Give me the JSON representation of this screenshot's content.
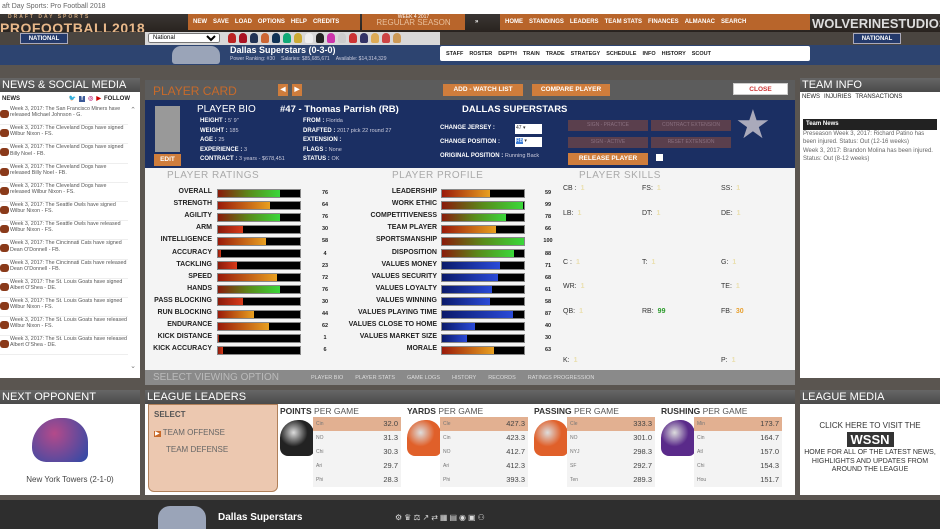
{
  "window_title": "aft Day Sports: Pro Football 2018",
  "logo": {
    "top": "DRAFT DAY SPORTS",
    "main": "PROFOOTBALL2018"
  },
  "menu": [
    "NEW",
    "SAVE",
    "LOAD",
    "OPTIONS",
    "HELP",
    "CREDITS"
  ],
  "week": {
    "line": "WEEK 4 2017",
    "season": "REGULAR SEASON"
  },
  "nav": [
    "HOME",
    "STANDINGS",
    "LEADERS",
    "TEAM STATS",
    "FINANCES",
    "ALMANAC",
    "SEARCH"
  ],
  "studio": "WOLVERINESTUDIOS",
  "conference_badge": "NATIONAL",
  "team_select": "National",
  "team_helmet_colors": [
    "#b22",
    "#a12",
    "#235",
    "#c63",
    "#135",
    "#1a7",
    "#ca3",
    "#eee",
    "#222",
    "#c3a",
    "#ccc",
    "#c33",
    "#336",
    "#da5",
    "#c44",
    "#c95"
  ],
  "team": {
    "name": "Dallas Superstars (0-3-0)",
    "power_ranking": "Power Ranking: #30",
    "salaries": "Salaries: $85,685,671",
    "available": "Available: $14,314,329"
  },
  "team_buttons": [
    "STAFF",
    "ROSTER",
    "DEPTH",
    "TRAIN",
    "TRADE",
    "STRATEGY",
    "SCHEDULE",
    "INFO",
    "HISTORY",
    "SCOUT"
  ],
  "news": {
    "title": "NEWS & SOCIAL MEDIA",
    "tab": "NEWS",
    "follow": "FOLLOW",
    "items": [
      "Week 3, 2017: The San Francisco Miners have released Michael Johnson - G.",
      "Week 3, 2017: The Cleveland Dogs have signed Wilbur Nixon - FS.",
      "Week 3, 2017: The Cleveland Dogs have signed Billy Noel - FB.",
      "Week 3, 2017: The Cleveland Dogs have released Billy Noel - FB.",
      "Week 3, 2017: The Cleveland Dogs have released Wilbur Nixon - FS.",
      "Week 3, 2017: The Seattle Owls have signed Wilbur Nixon - FS.",
      "Week 3, 2017: The Seattle Owls have released Wilbur Nixon - FS.",
      "Week 3, 2017: The Cincinnati Cats have signed Dean O'Donnell - FB.",
      "Week 3, 2017: The Cincinnati Cats have released Dean O'Donnell - FB.",
      "Week 3, 2017: The St. Louis Goats have signed Albert O'Shea - DE.",
      "Week 3, 2017: The St. Louis Goats have signed Wilbur Nixon - FS.",
      "Week 3, 2017: The St. Louis Goats have released Wilbur Nixon - FS.",
      "Week 3, 2017: The St. Louis Goats have released Albert O'Shea - DE."
    ]
  },
  "card": {
    "title": "PLAYER CARD",
    "watch": "ADD - WATCH LIST",
    "compare": "COMPARE PLAYER",
    "close": "CLOSE",
    "edit": "EDIT",
    "bio_title": "PLAYER BIO",
    "player": "#47 - Thomas Parrish (RB)",
    "team": "DALLAS SUPERSTARS",
    "bio_left": [
      [
        "HEIGHT :",
        "5' 9\""
      ],
      [
        "WEIGHT :",
        "185"
      ],
      [
        "AGE :",
        "25"
      ],
      [
        "EXPERIENCE :",
        "3"
      ],
      [
        "CONTRACT :",
        "3 years - $678,451"
      ]
    ],
    "bio_right": [
      [
        "FROM :",
        "Florida"
      ],
      [
        "DRAFTED :",
        "2017 pick 22 round 27"
      ],
      [
        "EXTENSION :",
        ""
      ],
      [
        "FLAGS :",
        "None"
      ],
      [
        "STATUS :",
        "OK"
      ]
    ],
    "change_jersey": "CHANGE JERSEY :",
    "jersey": "47",
    "change_position": "CHANGE POSITION :",
    "position": "RB",
    "original_position": "ORIGINAL POSITION :",
    "original_value": "Running Back",
    "buttons": [
      "SIGN - PRACTICE",
      "CONTRACT EXTENSION",
      "SIGN - ACTIVE",
      "RESET EXTENSION"
    ],
    "release": "RELEASE PLAYER"
  },
  "ratings": {
    "title": "PLAYER RATINGS",
    "items": [
      [
        "OVERALL",
        76
      ],
      [
        "STRENGTH",
        64
      ],
      [
        "AGILITY",
        76
      ],
      [
        "ARM",
        30
      ],
      [
        "INTELLIGENCE",
        58
      ],
      [
        "ACCURACY",
        4
      ],
      [
        "TACKLING",
        23
      ],
      [
        "SPEED",
        72
      ],
      [
        "HANDS",
        76
      ],
      [
        "PASS BLOCKING",
        30
      ],
      [
        "RUN BLOCKING",
        44
      ],
      [
        "ENDURANCE",
        62
      ],
      [
        "KICK DISTANCE",
        1
      ],
      [
        "KICK ACCURACY",
        6
      ]
    ]
  },
  "profile": {
    "title": "PLAYER PROFILE",
    "items": [
      [
        "LEADERSHIP",
        59
      ],
      [
        "WORK ETHIC",
        99
      ],
      [
        "COMPETITIVENESS",
        78
      ],
      [
        "TEAM PLAYER",
        66
      ],
      [
        "SPORTSMANSHIP",
        100
      ],
      [
        "DISPOSITION",
        88
      ],
      [
        "VALUES MONEY",
        71
      ],
      [
        "VALUES SECURITY",
        68
      ],
      [
        "VALUES LOYALTY",
        61
      ],
      [
        "VALUES WINNING",
        58
      ],
      [
        "VALUES PLAYING TIME",
        87
      ],
      [
        "VALUES CLOSE TO HOME",
        40
      ],
      [
        "VALUES MARKET SIZE",
        30
      ],
      [
        "MORALE",
        63
      ]
    ]
  },
  "skills": {
    "title": "PLAYER SKILLS",
    "items": [
      [
        "CB :",
        "1"
      ],
      [
        "FS:",
        "1"
      ],
      [
        "SS:",
        "1"
      ],
      [
        "LB:",
        "1"
      ],
      [
        "DT:",
        "1"
      ],
      [
        "DE:",
        "1"
      ],
      [
        "C :",
        "1"
      ],
      [
        "T:",
        "1"
      ],
      [
        "G:",
        "1"
      ],
      [
        "WR:",
        "1"
      ],
      [
        "TE:",
        "1"
      ],
      [
        "QB:",
        "1"
      ],
      [
        "RB:",
        "99"
      ],
      [
        "FB:",
        "30"
      ],
      [
        "K:",
        "1"
      ],
      [
        "P:",
        "1"
      ]
    ]
  },
  "viewing": {
    "title": "SELECT VIEWING OPTION",
    "options": [
      "PLAYER BIO",
      "PLAYER STATS",
      "GAME LOGS",
      "HISTORY",
      "RECORDS",
      "RATINGS PROGRESSION"
    ]
  },
  "team_info": {
    "title": "TEAM INFO",
    "tabs": [
      "NEWS",
      "INJURIES",
      "TRANSACTIONS"
    ],
    "header": "Team News",
    "items": [
      "Preseason Week 3, 2017: Richard Patino has been injured. Status: Out (12-16 weeks)",
      "Week 3, 2017: Brandon Molina has been injured. Status: Out (8-12 weeks)"
    ]
  },
  "opponent": {
    "title": "NEXT OPPONENT",
    "name": "New York Towers (2-1-0)"
  },
  "leaders": {
    "title": "LEAGUE LEADERS",
    "select": "SELECT",
    "options": [
      "TEAM OFFENSE",
      "TEAM DEFENSE"
    ],
    "categories": [
      {
        "bold": "POINTS",
        "rest": "PER GAME",
        "helmet": "#222",
        "rows": [
          [
            "Cin",
            "32.0"
          ],
          [
            "NO",
            "31.3"
          ],
          [
            "Chi",
            "30.3"
          ],
          [
            "Ari",
            "29.7"
          ],
          [
            "Phi",
            "28.3"
          ]
        ]
      },
      {
        "bold": "YARDS",
        "rest": "PER GAME",
        "helmet": "#e0602a",
        "rows": [
          [
            "Cle",
            "427.3"
          ],
          [
            "Cin",
            "423.3"
          ],
          [
            "NO",
            "412.7"
          ],
          [
            "Ari",
            "412.3"
          ],
          [
            "Phi",
            "393.3"
          ]
        ]
      },
      {
        "bold": "PASSING",
        "rest": "PER GAME",
        "helmet": "#e0602a",
        "rows": [
          [
            "Cle",
            "333.3"
          ],
          [
            "NO",
            "301.0"
          ],
          [
            "NYJ",
            "298.3"
          ],
          [
            "SF",
            "292.7"
          ],
          [
            "Ten",
            "289.3"
          ]
        ]
      },
      {
        "bold": "RUSHING",
        "rest": "PER GAME",
        "helmet": "#5a2a8a",
        "rows": [
          [
            "Min",
            "173.7"
          ],
          [
            "Cin",
            "164.7"
          ],
          [
            "Atl",
            "157.0"
          ],
          [
            "Chi",
            "154.3"
          ],
          [
            "Hou",
            "151.7"
          ]
        ]
      }
    ]
  },
  "media": {
    "title": "LEAGUE MEDIA",
    "line1": "CLICK HERE TO VISIT THE",
    "brand": "WSSN",
    "line2": "HOME FOR ALL OF THE LATEST NEWS, HIGHLIGHTS AND UPDATES FROM AROUND THE LEAGUE"
  },
  "footer": {
    "team": "Dallas Superstars"
  }
}
